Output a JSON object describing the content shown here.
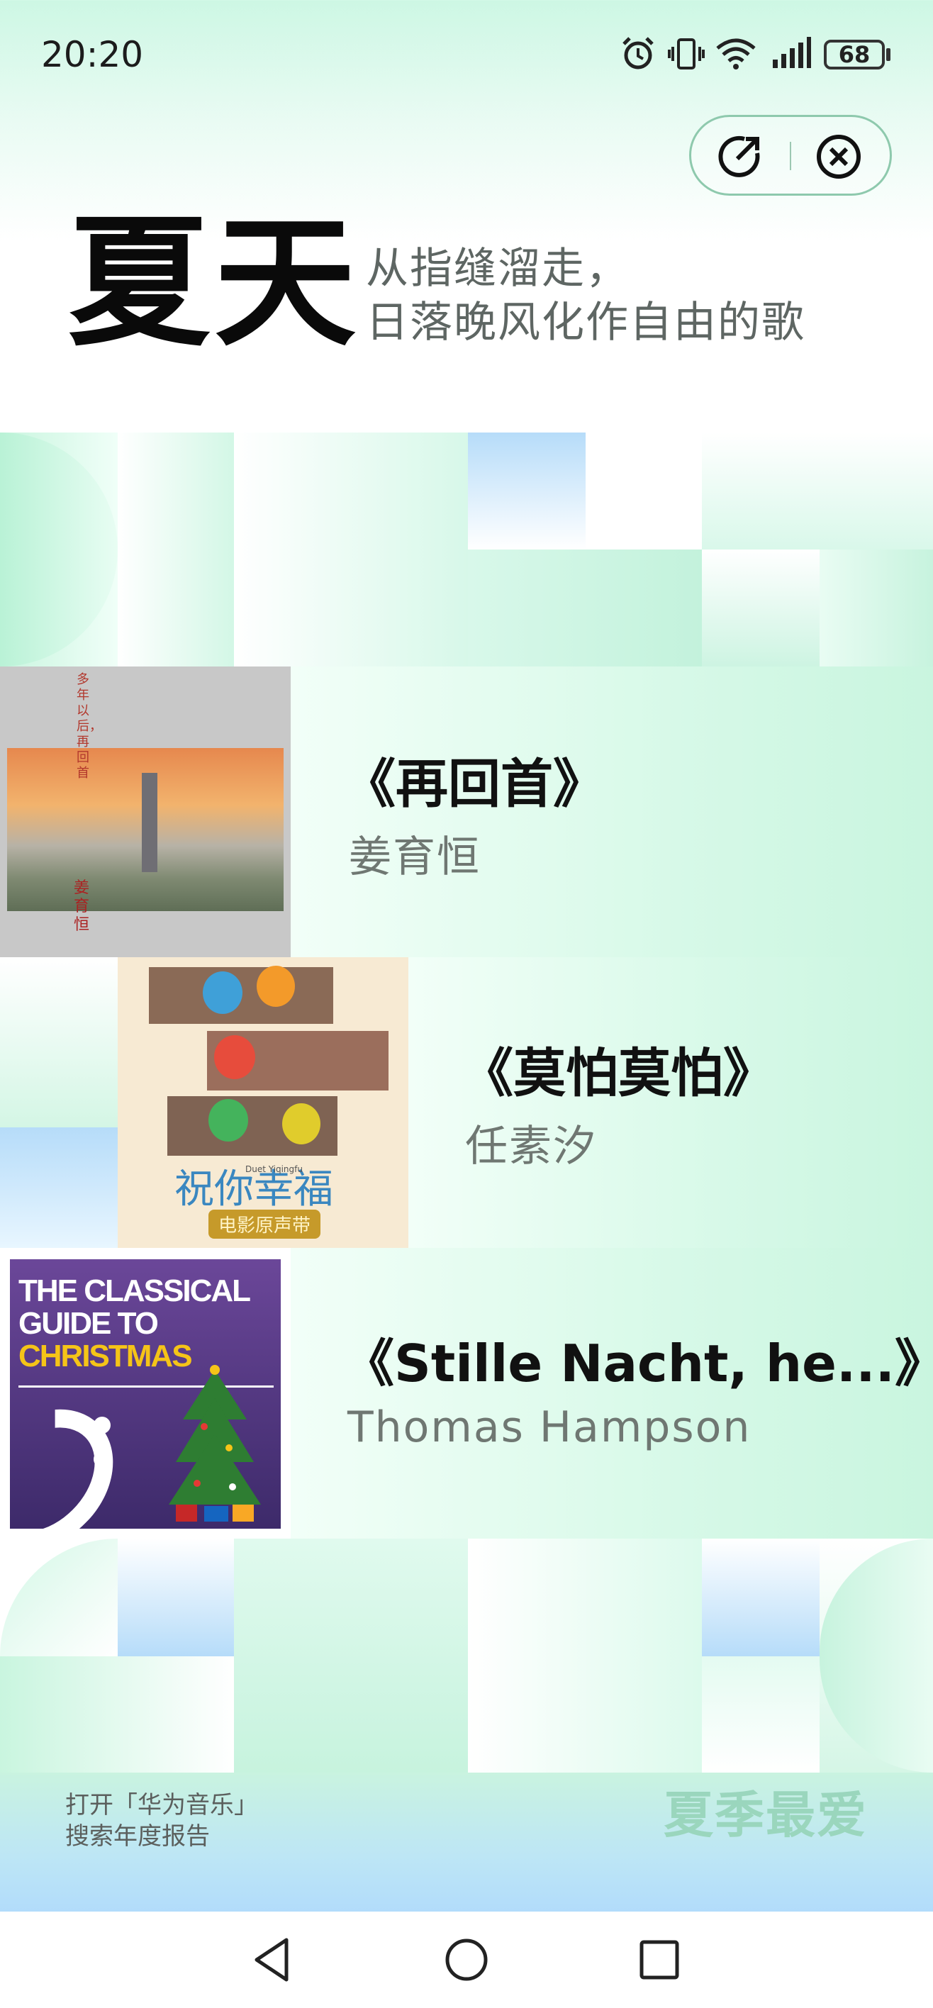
{
  "status_bar": {
    "time": "20:20",
    "battery": "68",
    "icons": [
      "alarm-icon",
      "vibrate-icon",
      "wifi-icon",
      "signal-icon",
      "battery-icon"
    ]
  },
  "actions": {
    "share_icon": "share-icon",
    "close_icon": "close-icon"
  },
  "header": {
    "title": "夏天",
    "subtitle_line1": "从指缝溜走，",
    "subtitle_line2": "日落晚风化作自由的歌"
  },
  "songs": [
    {
      "title": "《再回首》",
      "artist": "姜育恒",
      "cover": {
        "vertical_text": "多年以后，再回首",
        "artist_mark": "姜育恒"
      }
    },
    {
      "title": "《莫怕莫怕》",
      "artist": "任素汐",
      "cover": {
        "title_art": "祝你幸福",
        "subtitle": "Duet Yiqingfu",
        "badge": "电影原声带"
      }
    },
    {
      "title": "《Stille Nacht, he...》",
      "artist": "Thomas Hampson",
      "cover": {
        "line1": "THE CLASSICAL",
        "line2": "GUIDE TO",
        "line3": "CHRISTMAS"
      }
    }
  ],
  "footer": {
    "line1": "打开「华为音乐」",
    "line2": "搜索年度报告",
    "brand": "夏季最爱"
  },
  "nav": {
    "back_icon": "back-icon",
    "home_icon": "home-icon",
    "recents_icon": "recents-icon"
  },
  "colors": {
    "accent_mint": "#c9f5df",
    "accent_blue": "#b6dcf9",
    "brand_text": "#9ad6bd"
  }
}
